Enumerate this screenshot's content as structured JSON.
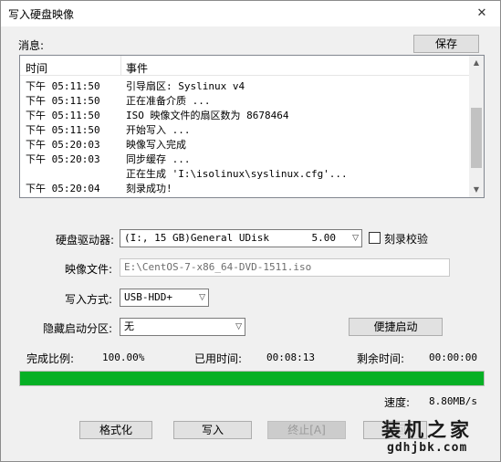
{
  "window": {
    "title": "写入硬盘映像",
    "close_glyph": "✕"
  },
  "log": {
    "section_label": "消息:",
    "save_label": "保存",
    "columns": {
      "time": "时间",
      "event": "事件"
    },
    "rows": [
      {
        "time": "下午 05:11:50",
        "event": "引导扇区: Syslinux v4"
      },
      {
        "time": "下午 05:11:50",
        "event": "正在准备介质 ..."
      },
      {
        "time": "下午 05:11:50",
        "event": "ISO 映像文件的扇区数为 8678464"
      },
      {
        "time": "下午 05:11:50",
        "event": "开始写入 ..."
      },
      {
        "time": "下午 05:20:03",
        "event": "映像写入完成"
      },
      {
        "time": "下午 05:20:03",
        "event": "同步缓存 ..."
      },
      {
        "time": "",
        "event": "正在生成 'I:\\isolinux\\syslinux.cfg'..."
      },
      {
        "time": "下午 05:20:04",
        "event": "刻录成功!"
      }
    ],
    "scroll_position": 0.72
  },
  "form": {
    "drive_label": "硬盘驱动器:",
    "drive_value": "(I:, 15 GB)General UDisk",
    "drive_capacity": "5.00",
    "verify_label": "刻录校验",
    "verify_checked": false,
    "image_label": "映像文件:",
    "image_value": "E:\\CentOS-7-x86_64-DVD-1511.iso",
    "method_label": "写入方式:",
    "method_value": "USB-HDD+",
    "hidden_label": "隐藏启动分区:",
    "hidden_value": "无",
    "quick_boot_label": "便捷启动"
  },
  "status": {
    "progress_label": "完成比例:",
    "progress_value": "100.00%",
    "progress_fraction": 1.0,
    "elapsed_label": "已用时间:",
    "elapsed_value": "00:08:13",
    "remaining_label": "剩余时间:",
    "remaining_value": "00:00:00",
    "speed_label": "速度:",
    "speed_value": "8.80MB/s"
  },
  "buttons": {
    "format": "格式化",
    "write": "写入",
    "stop": "终止[A]",
    "back": "返回"
  },
  "watermark": {
    "line1": "装机之家",
    "line2": "gdhjbk.com"
  },
  "colors": {
    "progress_fill": "#06b025",
    "window_bg": "#f0f0f0"
  }
}
